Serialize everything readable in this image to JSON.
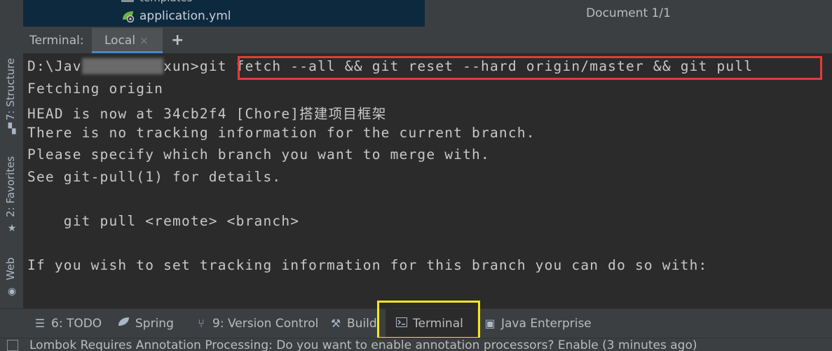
{
  "project_tree": {
    "folder_above": "templates",
    "file": "application.yml"
  },
  "document_status": "Document 1/1",
  "left_strip": {
    "structure": "7: Structure",
    "favorites": "2: Favorites",
    "web": "Web"
  },
  "terminal": {
    "title": "Terminal:",
    "tab_label": "Local",
    "tab_close": "×",
    "new_tab": "+",
    "prompt_start": "D:\\Jav",
    "prompt_end": "xun>",
    "command": "git fetch --all && git reset --hard origin/master && git pull",
    "lines": [
      "Fetching origin",
      "HEAD is now at 34cb2f4 [Chore]搭建项目框架",
      "There is no tracking information for the current branch.",
      "Please specify which branch you want to merge with.",
      "See git-pull(1) for details.",
      "",
      "    git pull <remote> <branch>",
      "",
      "If you wish to set tracking information for this branch you can do so with:"
    ]
  },
  "bottom_tabs": [
    {
      "label": "6: TODO",
      "icon": "todo-list-icon"
    },
    {
      "label": "Spring",
      "icon": "spring-leaf-icon"
    },
    {
      "label": "9: Version Control",
      "icon": "vcs-branch-icon"
    },
    {
      "label": "Build",
      "icon": "hammer-icon"
    },
    {
      "label": "Terminal",
      "icon": "terminal-icon"
    },
    {
      "label": "Java Enterprise",
      "icon": "java-enterprise-icon"
    }
  ],
  "status_bar": {
    "message": "Lombok Requires Annotation Processing: Do you want to enable annotation processors? Enable (3 minutes ago)"
  },
  "colors": {
    "command_highlight": "#e03c3c",
    "terminal_tab_highlight": "#f2e81a",
    "active_tab_underline": "#4a88c7"
  }
}
